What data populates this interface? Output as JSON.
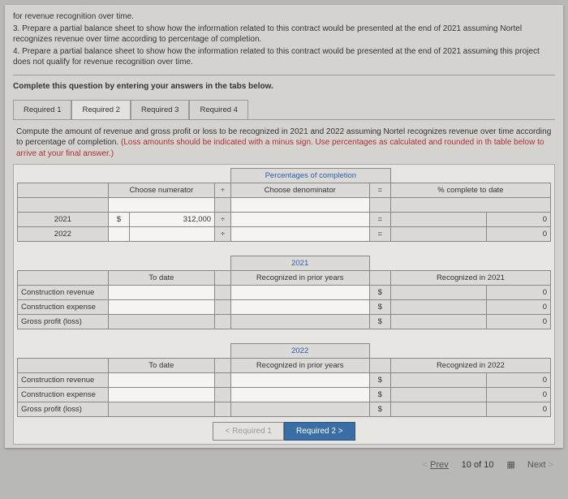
{
  "intro": {
    "line0": "for revenue recognition over time.",
    "line1": "3. Prepare a partial balance sheet to show how the information related to this contract would be presented at the end of 2021 assuming Nortel recognizes revenue over time according to percentage of completion.",
    "line2": "4. Prepare a partial balance sheet to show how the information related to this contract would be presented at the end of 2021 assuming this project does not qualify for revenue recognition over time."
  },
  "prompt_main": "Complete this question by entering your answers in the tabs below.",
  "tabs": {
    "r1": "Required 1",
    "r2": "Required 2",
    "r3": "Required 3",
    "r4": "Required 4"
  },
  "subprompt": {
    "black": "Compute the amount of revenue and gross profit or loss to be recognized in 2021 and 2022 assuming Nortel recognizes revenue over time according to percentage of completion. ",
    "red": "(Loss amounts should be indicated with a minus sign. Use percentages as calculated and rounded in th table below to arrive at your final answer.)"
  },
  "headers": {
    "percentages": "Percentages of completion",
    "choose_num": "Choose numerator",
    "choose_den": "Choose denominator",
    "divide": "÷",
    "equals": "=",
    "pct_complete": "% complete to date",
    "to_date": "To date",
    "rec_prior": "Recognized in prior years",
    "rec_2021": "Recognized in 2021",
    "rec_2022": "Recognized in 2022",
    "y2021": "2021",
    "y2022": "2022"
  },
  "rowlabels": {
    "y2021": "2021",
    "y2022": "2022",
    "rev": "Construction revenue",
    "exp": "Construction expense",
    "gp": "Gross profit (loss)"
  },
  "values": {
    "dollar": "$",
    "num_2021": "312,000",
    "plus": "÷",
    "zero": "0"
  },
  "navbtns": {
    "prev": "<  Required 1",
    "next": "Required 2  >"
  },
  "footer": {
    "prev": "Prev",
    "pos": "10",
    "of": "of",
    "total": "10",
    "next": "Next"
  }
}
